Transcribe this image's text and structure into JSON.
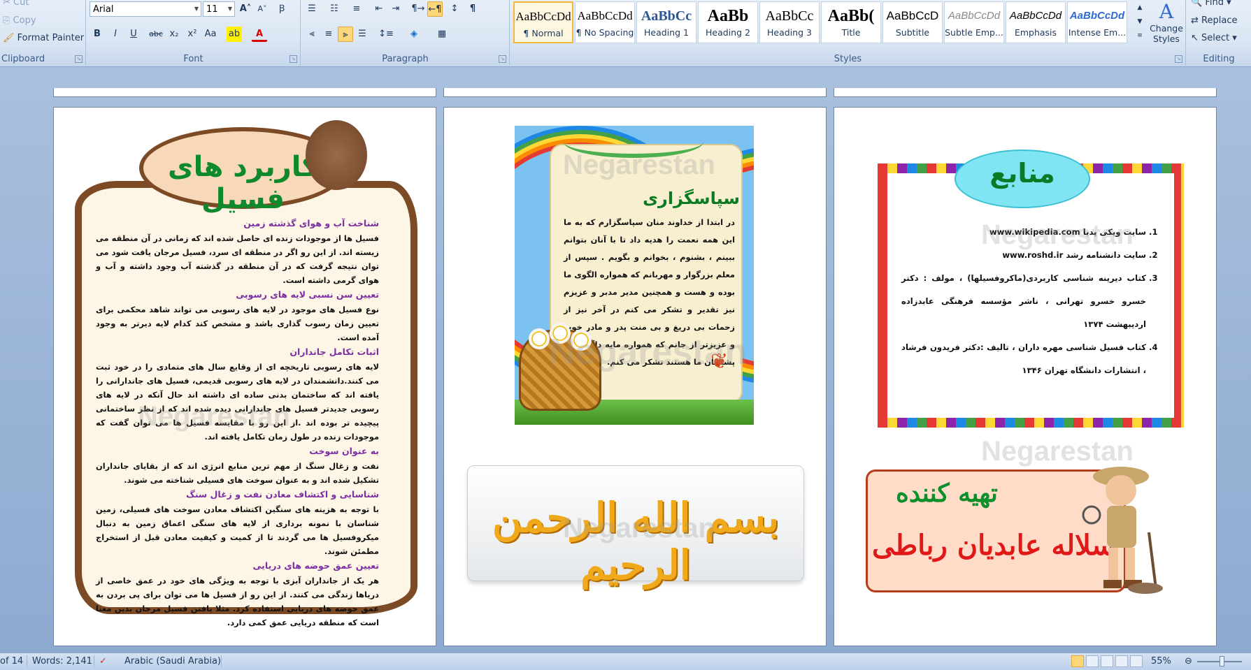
{
  "ribbon": {
    "clipboard": {
      "group_label": "Clipboard",
      "cut": "Cut",
      "copy": "Copy",
      "format_painter": "Format Painter"
    },
    "font": {
      "group_label": "Font",
      "font_name": "Arial",
      "font_size": "11",
      "grow": "A",
      "shrink": "A",
      "bold": "B",
      "italic": "I",
      "underline": "U",
      "strike": "abc",
      "subscript": "x₂",
      "superscript": "x²",
      "change_case": "Aa",
      "font_color": "A"
    },
    "paragraph": {
      "group_label": "Paragraph",
      "show_marks": "¶"
    },
    "styles": {
      "group_label": "Styles",
      "items": [
        {
          "sample": "AaBbCcDd",
          "name": "¶ Normal"
        },
        {
          "sample": "AaBbCcDd",
          "name": "¶ No Spacing"
        },
        {
          "sample": "AaBbCc",
          "name": "Heading 1"
        },
        {
          "sample": "AaBb",
          "name": "Heading 2"
        },
        {
          "sample": "AaBbCc",
          "name": "Heading 3"
        },
        {
          "sample": "AaBb(",
          "name": "Title"
        },
        {
          "sample": "AaBbCcD",
          "name": "Subtitle"
        },
        {
          "sample": "AaBbCcDd",
          "name": "Subtle Emp..."
        },
        {
          "sample": "AaBbCcDd",
          "name": "Emphasis"
        },
        {
          "sample": "AaBbCcDd",
          "name": "Intense Em..."
        }
      ],
      "change_styles": "Change Styles"
    },
    "editing": {
      "group_label": "Editing",
      "find": "Find",
      "replace": "Replace",
      "select": "Select"
    }
  },
  "document": {
    "watermark": "Negarestan",
    "page1": {
      "banner_title": "کاربرد های فسیل",
      "sections": [
        {
          "heading": "شناخت آب و هوای گذشته زمین",
          "text": "فسیل ها از موجودات زنده ای حاصل شده اند که زمانی در آن منطقه می زیسته اند. از این رو اگر در منطقه ای سرد، فسیل مرجان یافت شود می توان نتیجه گرفت که در آن منطقه در گذشته آب وجود داشته و آب و هوای گرمی داشته است."
        },
        {
          "heading": "تعیین سن نسبی لایه های رسوبی",
          "text": "نوع فسیل های موجود در لایه های رسوبی می تواند شاهد محکمی برای تعیین زمان رسوب گذاری باشد و مشخص کند کدام لایه دیرتر به وجود آمده است."
        },
        {
          "heading": "اثبات تکامل جانداران",
          "text": "لایه های رسوبی تاریخچه ای از وقایع سال های متمادی را در خود ثبت می کنند.دانشمندان در لایه های رسوبی قدیمی، فسیل های جاندارانی را یافته اند که ساختمان بدنی ساده ای داشته اند حال آنکه در لایه های رسوبی جدیدتر فسیل های جاندارانی دیده شده اند که از نظر ساختمانی پیچیده تر بوده اند .از این رو با مقایسه فسیل ها می توان گفت که موجودات زنده در طول زمان تکامل یافته اند."
        },
        {
          "heading": "به عنوان سوخت",
          "text": "نفت و زغال سنگ از مهم ترین منابع انرژی اند که از بقایای جانداران تشکیل شده اند و به عنوان سوخت های فسیلی شناخته می شوند."
        },
        {
          "heading": "شناسایی و اکتشاف معادن نفت و زغال سنگ",
          "text": "با توجه به هزینه های سنگین اکتشاف معادن سوخت های فسیلی، زمین شناسان با نمونه برداری از لایه های سنگی اعماق زمین به دنبال میکروفسیل ها می گردند تا از کمیت و کیفیت معادن قبل از استخراج مطمئن شوند."
        },
        {
          "heading": "تعیین عمق حوضه های دریایی",
          "text": "هر یک از جانداران آبزی با توجه به ویژگی های خود در عمق خاصی از دریاها زندگی می کنند. از این رو از فسیل ها می توان برای پی بردن به عمق حوضه های دریایی استفاده کرد. مثلا یافتن فسیل مرجان بدین معنا است که منطقه دریایی عمق کمی دارد."
        }
      ]
    },
    "page2": {
      "thanks_title": "سپاسگزاری",
      "thanks_body": "در ابتدا از خداوند منان سپاسگزارم که به ما این همه نعمت را هدیه داد تا با آنان بتوانم ببینم ، بشنوم ، بخوانم و بگویم . سپس از معلم بزرگوار و مهربانم که همواره الگوی ما بوده و هست و همچنین مدیر مدبر و عزیزم نیز تقدیر و تشکر می کنم در آخر نیز از زحمات بی دریغ و بی منت پدر و مادر خوب و عزیزتر از جانم که همواره مایه دلگرمی و پشتیبان ما هستند تشکر می کنم.",
      "bismillah": "بسم الله الرحمن الرحیم"
    },
    "page3": {
      "sources_title": "منابع",
      "references": [
        "سایت ویکی پدیا www.wikipedia.com",
        "سایت دانشنامه رشد www.roshd.ir",
        "کتاب دیرینه شناسی کاربردی(ماکروفسیلها) ، مولف : دکتر خسرو خسرو تهرانی ، ناشر مؤسسه فرهنگی عابدزاده اردیبهشت ۱۳۷۴",
        "کتاب فسیل شناسی مهره داران ، تالیف :دکتر فریدون فرشاد ، انتشارات دانشگاه تهران ۱۳۴۶"
      ],
      "author_label": "تهیه کننده",
      "author_name": "سلاله عابدیان رباطی"
    }
  },
  "status": {
    "page": "of 14",
    "words": "Words: 2,141",
    "language": "Arabic (Saudi Arabia)",
    "zoom": "55%"
  }
}
